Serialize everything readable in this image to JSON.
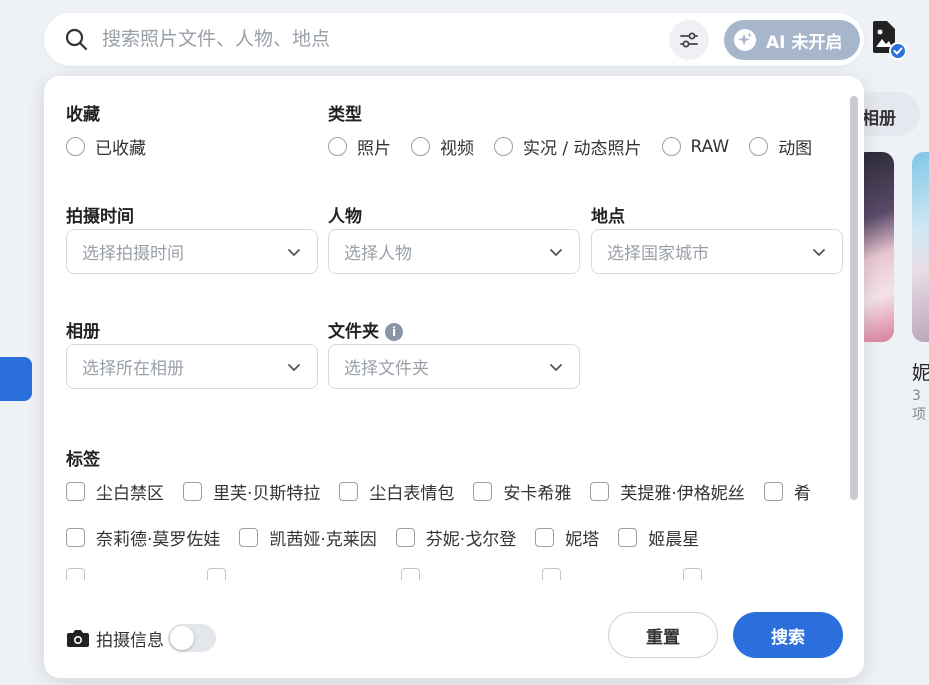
{
  "search": {
    "placeholder": "搜索照片文件、人物、地点"
  },
  "ai_button": {
    "label": "AI 未开启"
  },
  "background": {
    "chip_label": "相册",
    "item_title": "妮",
    "item_sub": "3项"
  },
  "filters": {
    "favorites": {
      "title": "收藏",
      "options": [
        "已收藏"
      ]
    },
    "type": {
      "title": "类型",
      "options": [
        "照片",
        "视频",
        "实况 / 动态照片",
        "RAW",
        "动图"
      ]
    },
    "shoot_time": {
      "title": "拍摄时间",
      "placeholder": "选择拍摄时间"
    },
    "people": {
      "title": "人物",
      "placeholder": "选择人物"
    },
    "location": {
      "title": "地点",
      "placeholder": "选择国家城市"
    },
    "album": {
      "title": "相册",
      "placeholder": "选择所在相册"
    },
    "folder": {
      "title": "文件夹",
      "placeholder": "选择文件夹"
    },
    "tags": {
      "title": "标签",
      "row1": [
        "尘白禁区",
        "里芙·贝斯特拉",
        "尘白表情包",
        "安卡希雅",
        "芙提雅·伊格妮丝",
        "肴"
      ],
      "row2": [
        "奈莉德·莫罗佐娃",
        "凯茜娅·克莱因",
        "芬妮·戈尔登",
        "妮塔",
        "姬晨星"
      ]
    }
  },
  "footer": {
    "shoot_info_label": "拍摄信息",
    "reset_label": "重置",
    "search_label": "搜索"
  },
  "colors": {
    "accent": "#2a6fdb",
    "ai_button_bg": "#a8b6cc"
  }
}
